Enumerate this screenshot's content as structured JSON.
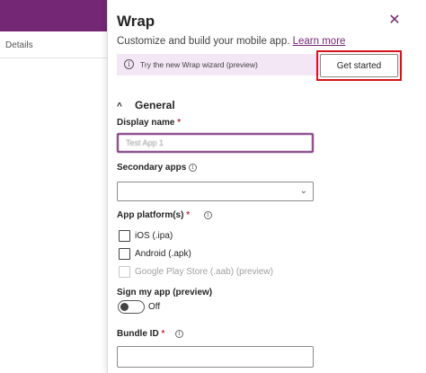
{
  "background": {
    "tab_label": "Details"
  },
  "panel": {
    "title": "Wrap",
    "subtitle": "Customize and build your mobile app.",
    "learn_more": "Learn more",
    "banner_text": "Try the new Wrap wizard (preview)",
    "get_started": "Get started",
    "section_title": "General",
    "display_name_label": "Display name",
    "display_name_value": "Test App 1",
    "secondary_apps_label": "Secondary apps",
    "platforms_label": "App platform(s)",
    "platforms": [
      {
        "label": "iOS (.ipa)",
        "disabled": false
      },
      {
        "label": "Android (.apk)",
        "disabled": false
      },
      {
        "label": "Google Play Store (.aab) (preview)",
        "disabled": true
      }
    ],
    "sign_label": "Sign my app (preview)",
    "sign_state": "Off",
    "bundle_label": "Bundle ID",
    "required_mark": "*",
    "info_glyph": "i"
  },
  "colors": {
    "accent": "#742774",
    "banner_bg": "#f3e6f5",
    "highlight": "#d7141c"
  },
  "icons": {
    "close": "close-icon",
    "info": "info-icon",
    "chevron_up": "chevron-up-icon",
    "chevron_down": "chevron-down-icon"
  }
}
